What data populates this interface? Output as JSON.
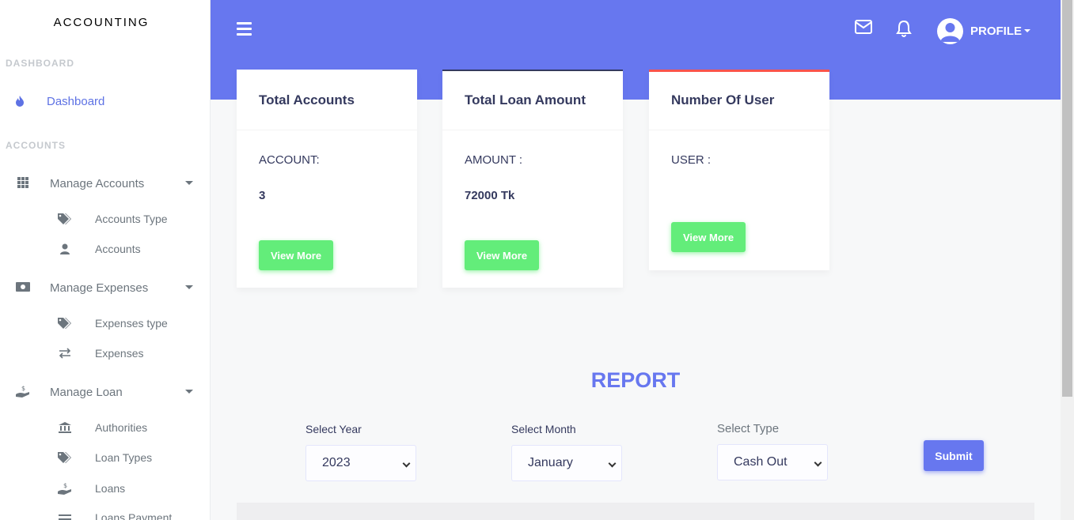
{
  "sidebar": {
    "brand": "ACCOUNTING",
    "section_dashboard": "DASHBOARD",
    "dashboard_item": {
      "label": "Dashboard",
      "icon": "fire-icon"
    },
    "section_accounts": "ACCOUNTS",
    "manage_accounts": {
      "label": "Manage Accounts",
      "icon": "grid-icon",
      "items": [
        {
          "label": "Accounts Type",
          "icon": "tags-icon"
        },
        {
          "label": "Accounts",
          "icon": "user-icon"
        }
      ]
    },
    "manage_expenses": {
      "label": "Manage Expenses",
      "icon": "money-bill-icon",
      "items": [
        {
          "label": "Expenses type",
          "icon": "tags-icon"
        },
        {
          "label": "Expenses",
          "icon": "exchange-icon"
        }
      ]
    },
    "manage_loan": {
      "label": "Manage Loan",
      "icon": "hand-dollar-icon",
      "items": [
        {
          "label": "Authorities",
          "icon": "bank-icon"
        },
        {
          "label": "Loan Types",
          "icon": "tags-icon"
        },
        {
          "label": "Loans",
          "icon": "hand-dollar-icon"
        },
        {
          "label": "Loans Payment",
          "icon": "list-icon"
        }
      ]
    }
  },
  "header": {
    "profile_label": "PROFILE",
    "accent": "#6777ef"
  },
  "cards": [
    {
      "title": "Total Accounts",
      "label": "ACCOUNT:",
      "value": "3",
      "button": "View More",
      "top_border": ""
    },
    {
      "title": "Total Loan Amount",
      "label": "AMOUNT :",
      "value": "72000 Tk",
      "button": "View More",
      "top_border": "#34395e"
    },
    {
      "title": "Number Of User",
      "label": "USER :",
      "value": "",
      "button": "View More",
      "top_border": "#fc544b"
    }
  ],
  "report": {
    "title": "REPORT",
    "year_label": "Select Year",
    "year_value": "2023",
    "month_label": "Select Month",
    "month_value": "January",
    "type_label": "Select Type",
    "type_value": "Cash Out",
    "submit": "Submit"
  }
}
